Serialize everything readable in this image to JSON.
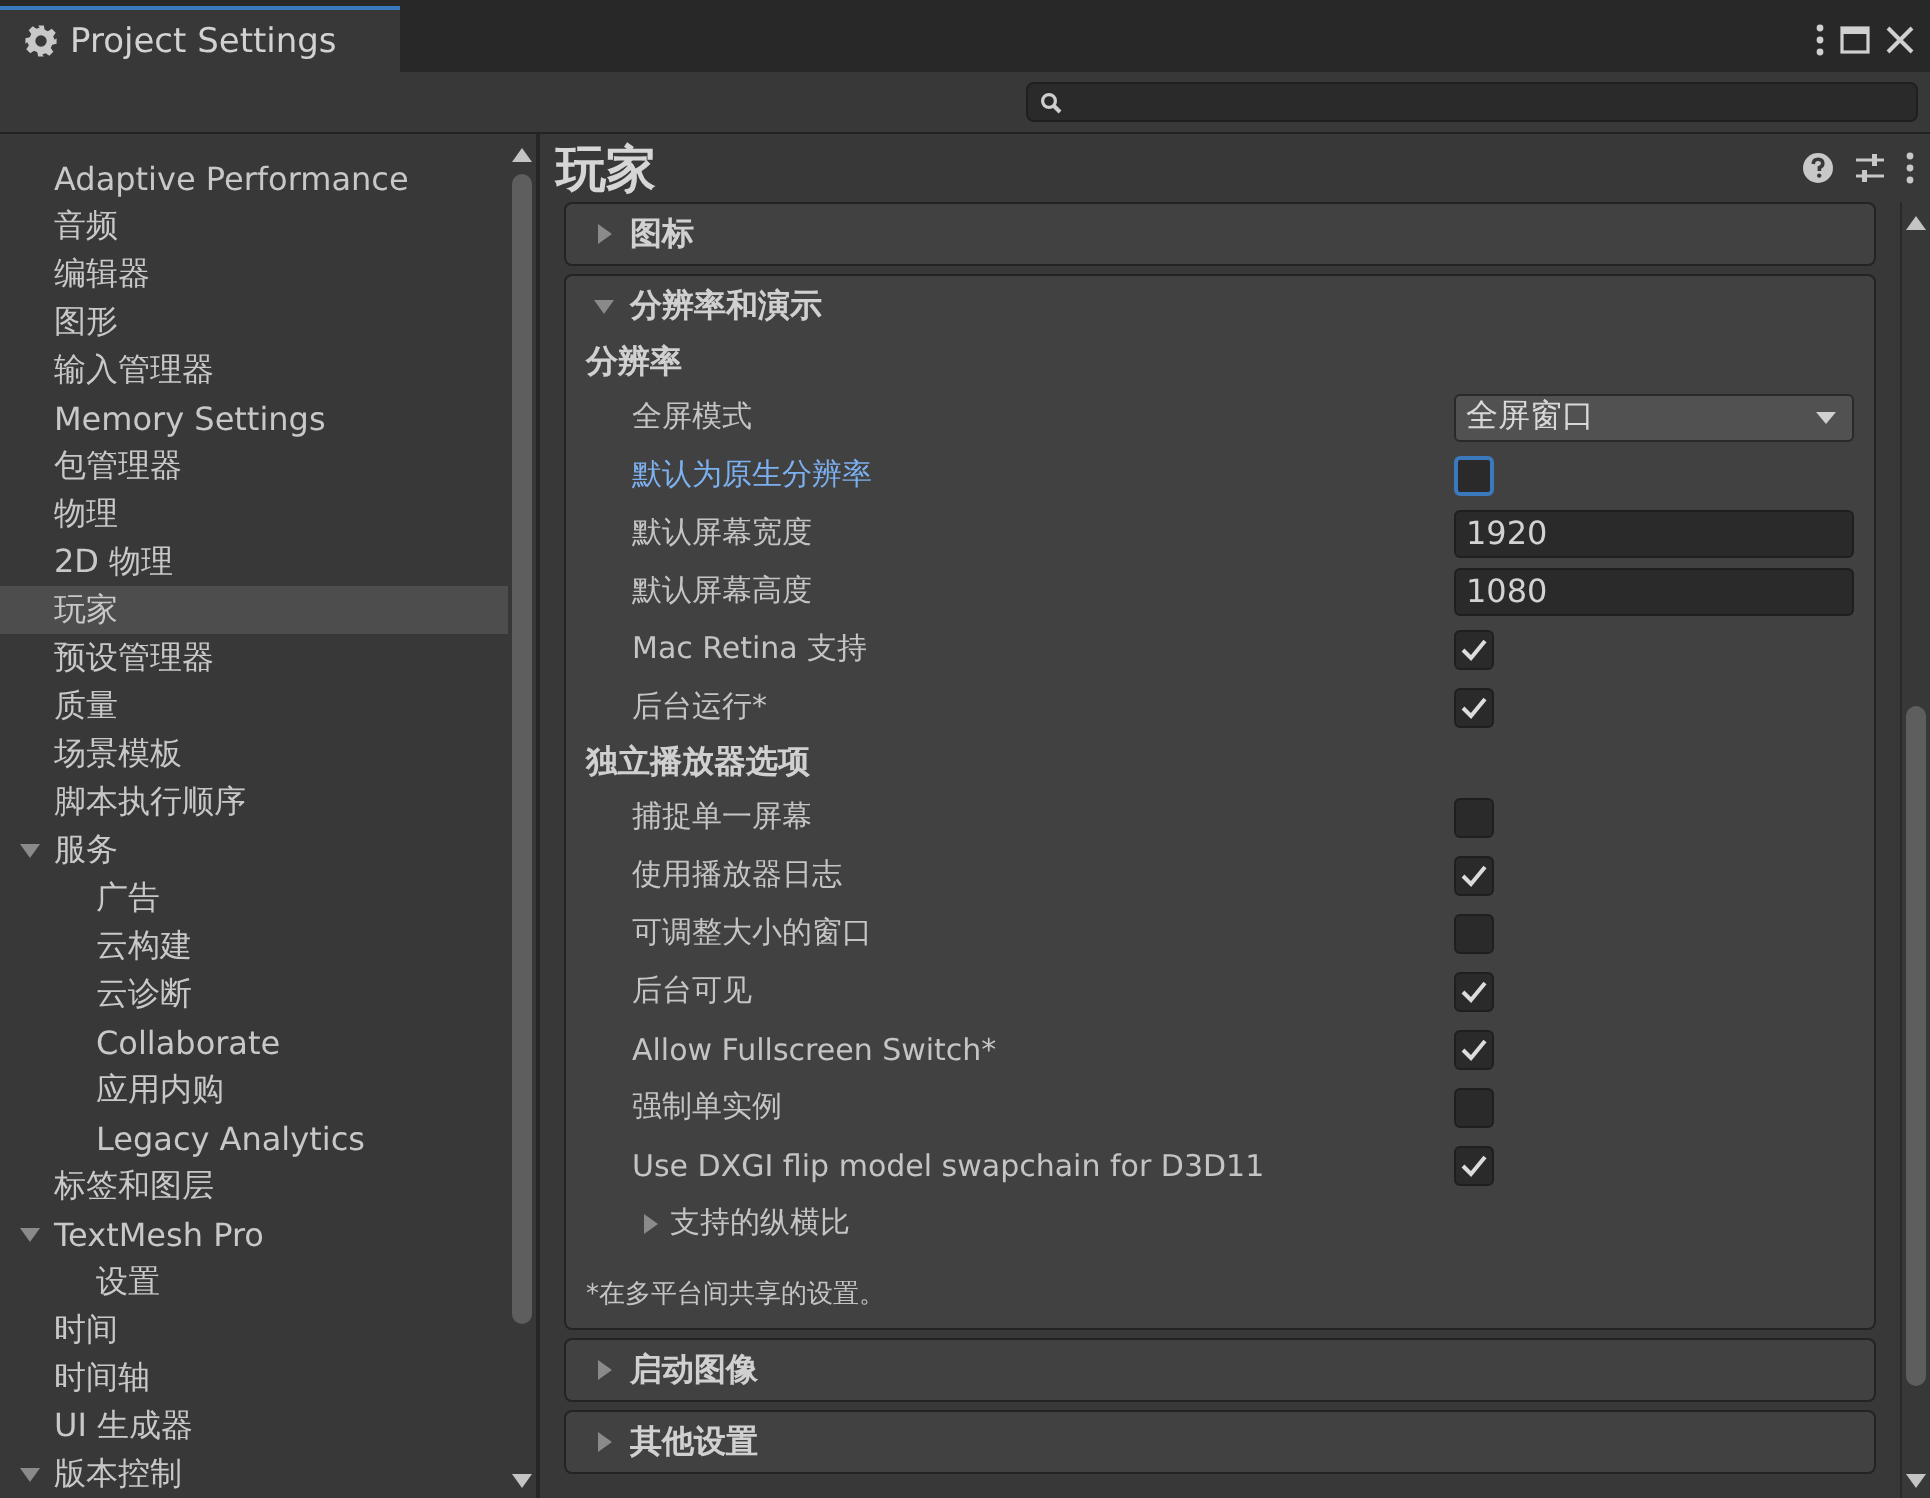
{
  "window": {
    "title": "Project Settings"
  },
  "sidebar": {
    "items": [
      {
        "label": "Adaptive Performance",
        "selected": false
      },
      {
        "label": "音频",
        "selected": false
      },
      {
        "label": "编辑器",
        "selected": false
      },
      {
        "label": "图形",
        "selected": false
      },
      {
        "label": "输入管理器",
        "selected": false
      },
      {
        "label": "Memory Settings",
        "selected": false
      },
      {
        "label": "包管理器",
        "selected": false
      },
      {
        "label": "物理",
        "selected": false
      },
      {
        "label": "2D 物理",
        "selected": false
      },
      {
        "label": "玩家",
        "selected": true
      },
      {
        "label": "预设管理器",
        "selected": false
      },
      {
        "label": "质量",
        "selected": false
      },
      {
        "label": "场景模板",
        "selected": false
      },
      {
        "label": "脚本执行顺序",
        "selected": false
      },
      {
        "label": "服务",
        "selected": false,
        "expanded": true,
        "children": [
          {
            "label": "广告",
            "selected": false
          },
          {
            "label": "云构建",
            "selected": false
          },
          {
            "label": "云诊断",
            "selected": false
          },
          {
            "label": "Collaborate",
            "selected": false
          },
          {
            "label": "应用内购",
            "selected": false
          },
          {
            "label": "Legacy Analytics",
            "selected": false
          }
        ]
      },
      {
        "label": "标签和图层",
        "selected": false
      },
      {
        "label": "TextMesh Pro",
        "selected": false,
        "expanded": true,
        "children": [
          {
            "label": "设置",
            "selected": false
          }
        ]
      },
      {
        "label": "时间",
        "selected": false
      },
      {
        "label": "时间轴",
        "selected": false
      },
      {
        "label": "UI 生成器",
        "selected": false
      },
      {
        "label": "版本控制",
        "selected": false,
        "expanded": true
      }
    ]
  },
  "page": {
    "title": "玩家"
  },
  "sections": [
    {
      "title": "图标",
      "expanded": false
    },
    {
      "title": "分辨率和演示",
      "expanded": true,
      "groups": [
        {
          "title": "分辨率",
          "rows": [
            {
              "kind": "dropdown",
              "label": "全屏模式",
              "value": "全屏窗口"
            },
            {
              "kind": "checkbox",
              "label": "默认为原生分辨率",
              "checked": false,
              "focused": true
            },
            {
              "kind": "text",
              "label": "默认屏幕宽度",
              "value": "1920"
            },
            {
              "kind": "text",
              "label": "默认屏幕高度",
              "value": "1080"
            },
            {
              "kind": "checkbox",
              "label": "Mac Retina 支持",
              "checked": true,
              "focused": false
            },
            {
              "kind": "checkbox",
              "label": "后台运行*",
              "checked": true,
              "focused": false
            }
          ]
        },
        {
          "title": "独立播放器选项",
          "rows": [
            {
              "kind": "checkbox",
              "label": "捕捉单一屏幕",
              "checked": false,
              "focused": false
            },
            {
              "kind": "checkbox",
              "label": "使用播放器日志",
              "checked": true,
              "focused": false
            },
            {
              "kind": "checkbox",
              "label": "可调整大小的窗口",
              "checked": false,
              "focused": false
            },
            {
              "kind": "checkbox",
              "label": "后台可见",
              "checked": true,
              "focused": false
            },
            {
              "kind": "checkbox",
              "label": "Allow Fullscreen Switch*",
              "checked": true,
              "focused": false
            },
            {
              "kind": "checkbox",
              "label": "强制单实例",
              "checked": false,
              "focused": false
            },
            {
              "kind": "checkbox",
              "label": "Use DXGI flip model swapchain for D3D11",
              "checked": true,
              "focused": false
            },
            {
              "kind": "foldout",
              "label": "支持的纵横比",
              "expanded": false
            }
          ]
        }
      ],
      "footnote": "*在多平台间共享的设置。"
    },
    {
      "title": "启动图像",
      "expanded": false
    },
    {
      "title": "其他设置",
      "expanded": false
    }
  ]
}
